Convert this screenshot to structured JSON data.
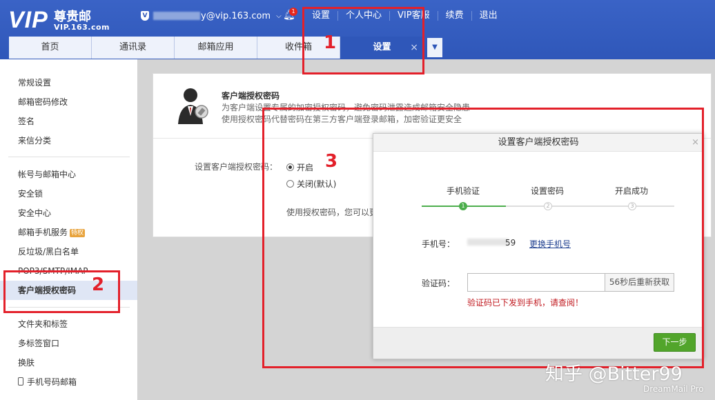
{
  "brand": {
    "vip": "VIP",
    "name": "尊贵邮",
    "domain": "VIP.163.com"
  },
  "account": {
    "email_suffix": "y@vip.163.com",
    "notification_count": "1"
  },
  "top_links": [
    "设置",
    "个人中心",
    "VIP客服",
    "续费",
    "退出"
  ],
  "tabs": [
    "首页",
    "通讯录",
    "邮箱应用",
    "收件箱",
    "设置"
  ],
  "sidebar": {
    "group1": [
      "常规设置",
      "邮箱密码修改",
      "签名",
      "来信分类"
    ],
    "group2": [
      "帐号与邮箱中心",
      "安全锁",
      "安全中心",
      "邮箱手机服务",
      "反垃圾/黑白名单",
      "POP3/SMTP/IMAP",
      "客户端授权密码"
    ],
    "badge": "特权",
    "group3": [
      "文件夹和标签",
      "多标签窗口",
      "换肤",
      "手机号码邮箱"
    ]
  },
  "section": {
    "title": "客户端授权密码",
    "desc1": "为客户端设置专属的加密授权密码，避免密码泄露造成邮箱安全隐患",
    "desc2": "使用授权密码代替密码在第三方客户端登录邮箱，加密验证更安全",
    "setting_label": "设置客户端授权密码：",
    "option_on": "开启",
    "option_off": "关闭(默认)",
    "use_desc": "使用授权密码，您可以更"
  },
  "dialog": {
    "title": "设置客户端授权密码",
    "close": "×",
    "steps": [
      "手机验证",
      "设置密码",
      "开启成功"
    ],
    "phone_label": "手机号：",
    "phone_tail": "59",
    "change_phone": "更换手机号",
    "code_label": "验证码：",
    "code_value": "",
    "resend": "56秒后重新获取",
    "sent_msg": "验证码已下发到手机，请查阅！",
    "next": "下一步",
    "current_step": 1
  },
  "annotations": [
    "1",
    "2",
    "3"
  ],
  "watermark": {
    "zhihu": "知乎 @Bitter99",
    "app": "DreamMail Pro"
  },
  "colors": {
    "header": "#2f57b9",
    "annotation": "#e3202a",
    "next_button": "#52a52b",
    "alert_text": "#c0181e"
  }
}
